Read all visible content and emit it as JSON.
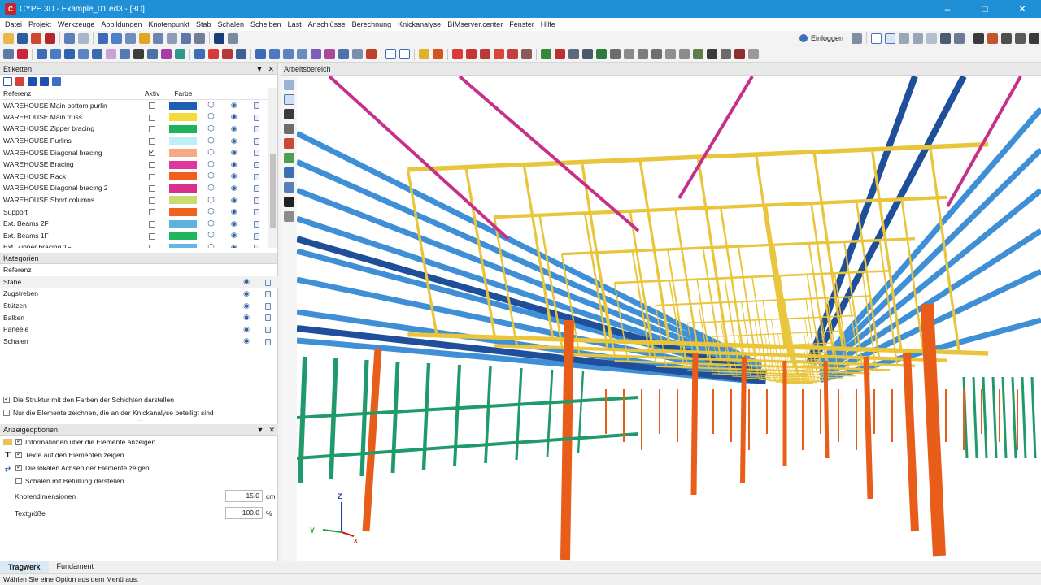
{
  "window": {
    "title": "CYPE 3D - Example_01.ed3 - [3D]",
    "app_icon_text": "C",
    "min": "–",
    "max": "□",
    "close": "✕"
  },
  "menu": [
    "Datei",
    "Projekt",
    "Werkzeuge",
    "Abbildungen",
    "Knotenpunkt",
    "Stab",
    "Schalen",
    "Scheiben",
    "Last",
    "Anschlüsse",
    "Berechnung",
    "Knickanalyse",
    "BIMserver.center",
    "Fenster",
    "Hilfe"
  ],
  "toolbar": {
    "login_label": "Einloggen"
  },
  "etiketten": {
    "title": "Etiketten",
    "columns": {
      "ref": "Referenz",
      "aktiv": "Aktiv",
      "farbe": "Farbe"
    },
    "rows": [
      {
        "ref": "WAREHOUSE Main bottom purlin",
        "aktiv": false,
        "color": "#1f5fb0"
      },
      {
        "ref": "WAREHOUSE Main truss",
        "aktiv": false,
        "color": "#f1dc3c"
      },
      {
        "ref": "WAREHOUSE Zipper bracing",
        "aktiv": false,
        "color": "#1db35a"
      },
      {
        "ref": "WAREHOUSE Purlins",
        "aktiv": false,
        "color": "#bfeef4"
      },
      {
        "ref": "WAREHOUSE Diagonal bracing",
        "aktiv": true,
        "color": "#f6a982"
      },
      {
        "ref": "WAREHOUSE Bracing",
        "aktiv": false,
        "color": "#e0379e"
      },
      {
        "ref": "WAREHOUSE Rack",
        "aktiv": false,
        "color": "#f0601b"
      },
      {
        "ref": "WAREHOUSE Diagonal bracing 2",
        "aktiv": false,
        "color": "#d9308c"
      },
      {
        "ref": "WAREHOUSE Short columns",
        "aktiv": false,
        "color": "#c9dc73"
      },
      {
        "ref": "Support",
        "aktiv": false,
        "color": "#f0641e"
      },
      {
        "ref": "Ext. Beams 2F",
        "aktiv": false,
        "color": "#5fb2e0"
      },
      {
        "ref": "Ext. Beams 1F",
        "aktiv": false,
        "color": "#1fb65f"
      },
      {
        "ref": "Ext. Zipper bracing 1F",
        "aktiv": false,
        "color": "#62b6e8"
      }
    ]
  },
  "kategorien": {
    "title": "Kategorien",
    "header": "Referenz",
    "rows": [
      "Stäbe",
      "Zugstreben",
      "Stützen",
      "Balken",
      "Paneele",
      "Schalen"
    ]
  },
  "checks": {
    "struct_colors": {
      "label": "Die Struktur mit den Farben der Schichten darstellen",
      "checked": true
    },
    "only_buckling": {
      "label": "Nur die Elemente zeichnen, die an der Knickanalyse beteiligt sind",
      "checked": false
    }
  },
  "anzeige": {
    "title": "Anzeigeoptionen",
    "opt_info": "Informationen über die Elemente anzeigen",
    "opt_text": "Texte auf den Elementen zeigen",
    "opt_axes": "Die lokalen Achsen der Elemente zeigen",
    "opt_shells": "Schalen mit Befüllung darstellen",
    "knoten_label": "Knotendimensionen",
    "knoten_value": "15.0",
    "knoten_unit": "cm",
    "text_label": "Textgröße",
    "text_value": "100.0",
    "text_unit": "%"
  },
  "workspace": {
    "title": "Arbeitsbereich",
    "axis_z": "Z",
    "axis_y": "Y",
    "axis_x": "X"
  },
  "tabs": [
    "Tragwerk",
    "Fundament"
  ],
  "status": "Wählen Sie eine Option aus dem Menü aus.",
  "colors": {
    "truss": "#e8c53a",
    "purlin": "#3f8fd6",
    "main_purlin": "#1f4f9a",
    "bracing": "#c6308b",
    "column": "#e85d1a",
    "rack_green": "#1f9a6a"
  }
}
